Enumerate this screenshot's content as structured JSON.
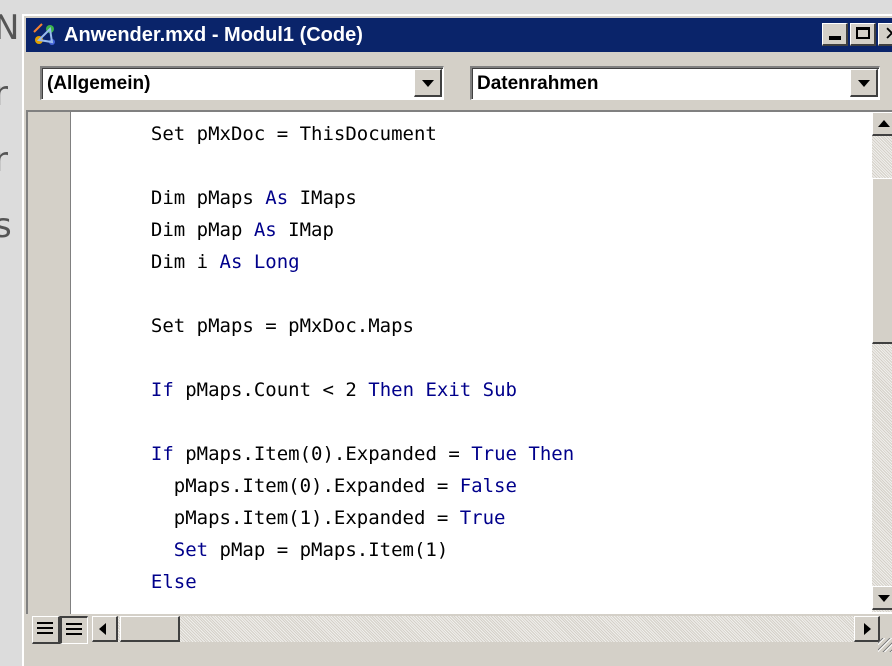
{
  "window": {
    "title": "Anwender.mxd - Modul1 (Code)",
    "buttons": {
      "minimize": "minimize-icon",
      "maximize": "maximize-icon",
      "close": "✕"
    }
  },
  "toolbar": {
    "object_combo": "(Allgemein)",
    "procedure_combo": "Datenrahmen"
  },
  "background_fragments": [
    "N",
    "r",
    "r",
    "s"
  ],
  "code_lines": [
    [
      {
        "t": "  Set pMxDoc = ThisDocument"
      }
    ],
    [
      {
        "t": ""
      }
    ],
    [
      {
        "t": "  Dim pMaps "
      },
      {
        "t": "As",
        "k": 1
      },
      {
        "t": " IMaps"
      }
    ],
    [
      {
        "t": "  Dim pMap "
      },
      {
        "t": "As",
        "k": 1
      },
      {
        "t": " IMap"
      }
    ],
    [
      {
        "t": "  Dim i "
      },
      {
        "t": "As Long",
        "k": 1
      }
    ],
    [
      {
        "t": ""
      }
    ],
    [
      {
        "t": "  Set pMaps = pMxDoc.Maps"
      }
    ],
    [
      {
        "t": ""
      }
    ],
    [
      {
        "t": "  "
      },
      {
        "t": "If",
        "k": 1
      },
      {
        "t": " pMaps.Count < 2 "
      },
      {
        "t": "Then Exit Sub",
        "k": 1
      }
    ],
    [
      {
        "t": ""
      }
    ],
    [
      {
        "t": "  "
      },
      {
        "t": "If",
        "k": 1
      },
      {
        "t": " pMaps.Item(0).Expanded = "
      },
      {
        "t": "True Then",
        "k": 1
      }
    ],
    [
      {
        "t": "    pMaps.Item(0).Expanded = "
      },
      {
        "t": "False",
        "k": 1
      }
    ],
    [
      {
        "t": "    pMaps.Item(1).Expanded = "
      },
      {
        "t": "True",
        "k": 1
      }
    ],
    [
      {
        "t": "    "
      },
      {
        "t": "Set",
        "k": 1
      },
      {
        "t": " pMap = pMaps.Item(1)"
      }
    ],
    [
      {
        "t": "  "
      },
      {
        "t": "Else",
        "k": 1
      }
    ]
  ],
  "colors": {
    "keyword": "#00008b",
    "titlebar": "#0a246a",
    "face": "#d4d0c8"
  }
}
